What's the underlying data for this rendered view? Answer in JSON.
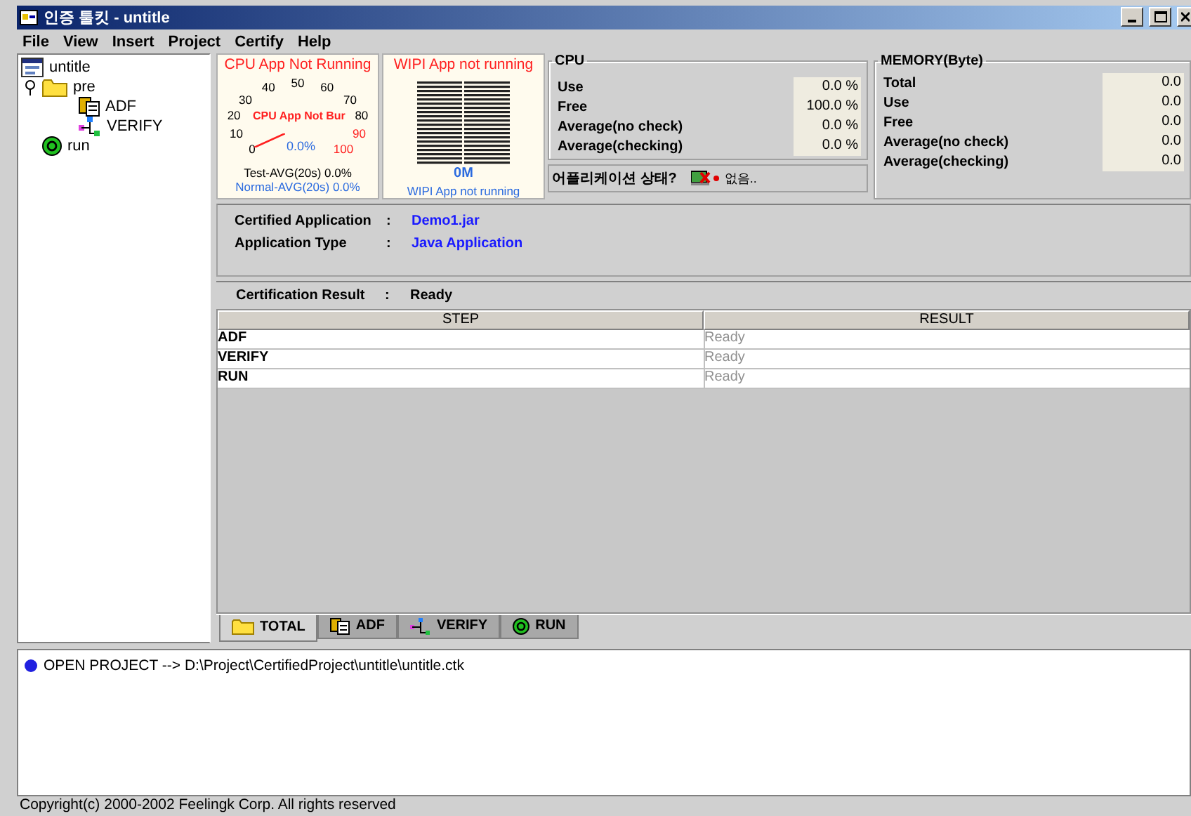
{
  "window": {
    "title": "인증 툴킷 - untitle"
  },
  "menu": [
    "File",
    "View",
    "Insert",
    "Project",
    "Certify",
    "Help"
  ],
  "tree": {
    "label": "untitle",
    "kind": "project",
    "children": [
      {
        "label": "pre",
        "kind": "folder",
        "expanded": true,
        "children": [
          {
            "label": "ADF",
            "kind": "adf"
          },
          {
            "label": "VERIFY",
            "kind": "verify"
          }
        ]
      },
      {
        "label": "run",
        "kind": "run"
      }
    ]
  },
  "cpu_gauge": {
    "title": "CPU App Not Running",
    "scale": [
      {
        "text": "0",
        "color": "#000000"
      },
      {
        "text": "10",
        "color": "#000000"
      },
      {
        "text": "20",
        "color": "#000000"
      },
      {
        "text": "30",
        "color": "#000000"
      },
      {
        "text": "40",
        "color": "#000000"
      },
      {
        "text": "50",
        "color": "#000000"
      },
      {
        "text": "60",
        "color": "#000000"
      },
      {
        "text": "70",
        "color": "#000000"
      },
      {
        "text": "80",
        "color": "#000000"
      },
      {
        "text": "90",
        "color": "#ff2020"
      },
      {
        "text": "100",
        "color": "#ff2020"
      }
    ],
    "status": "CPU App Not Bur",
    "reading": "0.0%",
    "test_avg": "Test-AVG(20s) 0.0%",
    "normal_avg": "Normal-AVG(20s) 0.0%"
  },
  "wipi": {
    "title": "WIPI App not running",
    "reading": "0M",
    "status": "WIPI App not running"
  },
  "cpu": {
    "title": "CPU",
    "rows": [
      {
        "label": "Use",
        "value": "0.0 %"
      },
      {
        "label": "Free",
        "value": "100.0 %"
      },
      {
        "label": "Average(no check)",
        "value": "0.0 %"
      },
      {
        "label": "Average(checking)",
        "value": "0.0 %"
      }
    ]
  },
  "app_state": {
    "label": "어플리케이션 상태?",
    "value": "없음.."
  },
  "memory": {
    "title": "MEMORY(Byte)",
    "rows": [
      {
        "label": "Total",
        "value": "0.0"
      },
      {
        "label": "Use",
        "value": "0.0"
      },
      {
        "label": "Free",
        "value": "0.0"
      },
      {
        "label": "Average(no check)",
        "value": "0.0"
      },
      {
        "label": "Average(checking)",
        "value": "0.0"
      }
    ]
  },
  "info": [
    {
      "label": "Certified Application",
      "separator": ":",
      "value": "Demo1.jar"
    },
    {
      "label": "Application Type",
      "separator": ":",
      "value": "Java Application"
    }
  ],
  "result": {
    "label": "Certification Result",
    "separator": ":",
    "value": "Ready"
  },
  "table": {
    "columns": [
      "STEP",
      "RESULT"
    ],
    "rows": [
      [
        "ADF",
        "Ready"
      ],
      [
        "VERIFY",
        "Ready"
      ],
      [
        "RUN",
        "Ready"
      ]
    ]
  },
  "tabs": [
    {
      "label": "TOTAL",
      "kind": "folder",
      "selected": true
    },
    {
      "label": "ADF",
      "kind": "adf",
      "selected": false
    },
    {
      "label": "VERIFY",
      "kind": "verify",
      "selected": false
    },
    {
      "label": "RUN",
      "kind": "run",
      "selected": false
    }
  ],
  "log": [
    {
      "text": "OPEN PROJECT --> D:\\Project\\CertifiedProject\\untitle\\untitle.ctk"
    }
  ],
  "status_bar": "Copyright(c) 2000-2002 Feelingk Corp. All rights reserved"
}
